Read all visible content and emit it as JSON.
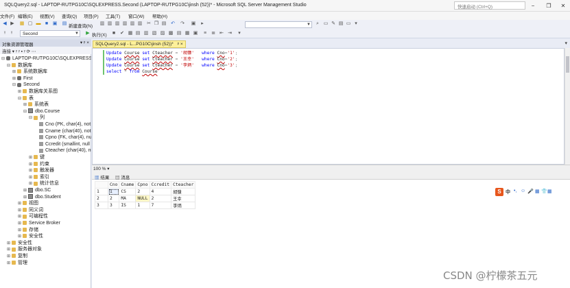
{
  "window": {
    "title": "SQLQuery2.sql - LAPTOP-RUTPG10C\\SQLEXPRESS.Second (LAPTOP-RUTPG10C\\jinsh (52))* - Microsoft SQL Server Management Studio",
    "quick_launch_placeholder": "快速启动 (Ctrl+Q)",
    "minimize": "−",
    "restore": "❐",
    "close": "✕"
  },
  "menu": [
    "文件(F)",
    "编辑(E)",
    "视图(V)",
    "查询(Q)",
    "项目(P)",
    "工具(T)",
    "窗口(W)",
    "帮助(H)"
  ],
  "toolbar": {
    "new_query_label": "新建查询(N)",
    "database_selected": "Second",
    "execute_label": "执行(X)"
  },
  "object_explorer": {
    "header": "对象资源管理器",
    "pins": "▾ ᵖ ×",
    "toolbar": "连接 ▾ ᵞ ᵞ ▪ ᵞ ⟳ ⋯",
    "tree": [
      {
        "label": "LAPTOP-RUTPG10C\\SQLEXPRESS (SC",
        "level": 0,
        "exp": "⊟",
        "icon": "dbi"
      },
      {
        "label": "数据库",
        "level": 1,
        "exp": "⊟",
        "icon": "folder"
      },
      {
        "label": "系统数据库",
        "level": 2,
        "exp": "⊞",
        "icon": "folder"
      },
      {
        "label": "First",
        "level": 2,
        "exp": "⊞",
        "icon": "dbi"
      },
      {
        "label": "Second",
        "level": 2,
        "exp": "⊟",
        "icon": "dbi"
      },
      {
        "label": "数据库关系图",
        "level": 3,
        "exp": "⊞",
        "icon": "folder"
      },
      {
        "label": "表",
        "level": 3,
        "exp": "⊟",
        "icon": "folder"
      },
      {
        "label": "系统表",
        "level": 4,
        "exp": "⊞",
        "icon": "folder"
      },
      {
        "label": "dbo.Course",
        "level": 4,
        "exp": "⊟",
        "icon": "tbli"
      },
      {
        "label": "列",
        "level": 5,
        "exp": "⊟",
        "icon": "folder"
      },
      {
        "label": "Cno (PK, char(4), not",
        "level": 6,
        "exp": "",
        "icon": "coli"
      },
      {
        "label": "Cname (char(40), not",
        "level": 6,
        "exp": "",
        "icon": "coli"
      },
      {
        "label": "Cpno (FK, char(4), nul",
        "level": 6,
        "exp": "",
        "icon": "coli"
      },
      {
        "label": "Ccredit (smallint, null",
        "level": 6,
        "exp": "",
        "icon": "coli"
      },
      {
        "label": "Cteacher (char(40), nu",
        "level": 6,
        "exp": "",
        "icon": "coli"
      },
      {
        "label": "键",
        "level": 5,
        "exp": "⊞",
        "icon": "folder"
      },
      {
        "label": "约束",
        "level": 5,
        "exp": "⊞",
        "icon": "folder"
      },
      {
        "label": "触发器",
        "level": 5,
        "exp": "⊞",
        "icon": "folder"
      },
      {
        "label": "索引",
        "level": 5,
        "exp": "⊞",
        "icon": "folder"
      },
      {
        "label": "统计信息",
        "level": 5,
        "exp": "⊞",
        "icon": "folder"
      },
      {
        "label": "dbo.SC",
        "level": 4,
        "exp": "⊞",
        "icon": "tbli"
      },
      {
        "label": "dbo.Student",
        "level": 4,
        "exp": "⊞",
        "icon": "tbli"
      },
      {
        "label": "视图",
        "level": 3,
        "exp": "⊞",
        "icon": "folder"
      },
      {
        "label": "同义词",
        "level": 3,
        "exp": "⊞",
        "icon": "folder"
      },
      {
        "label": "可编程性",
        "level": 3,
        "exp": "⊞",
        "icon": "folder"
      },
      {
        "label": "Service Broker",
        "level": 3,
        "exp": "⊞",
        "icon": "folder"
      },
      {
        "label": "存储",
        "level": 3,
        "exp": "⊞",
        "icon": "folder"
      },
      {
        "label": "安全性",
        "level": 3,
        "exp": "⊞",
        "icon": "folder"
      },
      {
        "label": "安全性",
        "level": 1,
        "exp": "⊞",
        "icon": "folder"
      },
      {
        "label": "服务器对象",
        "level": 1,
        "exp": "⊞",
        "icon": "folder"
      },
      {
        "label": "复制",
        "level": 1,
        "exp": "⊞",
        "icon": "folder"
      },
      {
        "label": "管理",
        "level": 1,
        "exp": "⊞",
        "icon": "folder"
      }
    ]
  },
  "editor": {
    "tab_title": "SQLQuery2.sql - L...PG10C\\jinsh (52))*",
    "tab_pin": "ᵖ ×",
    "code": [
      {
        "parts": [
          [
            "kw",
            "Update"
          ],
          [
            "t",
            " "
          ],
          [
            "ident",
            "Course"
          ],
          [
            "t",
            " "
          ],
          [
            "kw",
            "set"
          ],
          [
            "t",
            " "
          ],
          [
            "ident",
            "Cteacher"
          ],
          [
            "t",
            " "
          ],
          [
            "gray",
            "="
          ],
          [
            "t",
            " "
          ],
          [
            "str",
            "'胡慷'"
          ],
          [
            "t",
            "   "
          ],
          [
            "kw",
            "where"
          ],
          [
            "t",
            " "
          ],
          [
            "ident",
            "Cno"
          ],
          [
            "gray",
            "="
          ],
          [
            "str",
            "'1'"
          ],
          [
            "gray",
            ";"
          ]
        ]
      },
      {
        "parts": [
          [
            "kw",
            "Update"
          ],
          [
            "t",
            " "
          ],
          [
            "ident",
            "Course"
          ],
          [
            "t",
            " "
          ],
          [
            "kw",
            "set"
          ],
          [
            "t",
            " "
          ],
          [
            "ident",
            "Cteacher"
          ],
          [
            "t",
            " "
          ],
          [
            "gray",
            "="
          ],
          [
            "t",
            " "
          ],
          [
            "str",
            "'王幸'"
          ],
          [
            "t",
            "   "
          ],
          [
            "kw",
            "where"
          ],
          [
            "t",
            " "
          ],
          [
            "ident",
            "Cno"
          ],
          [
            "gray",
            "="
          ],
          [
            "str",
            "'2'"
          ],
          [
            "gray",
            ";"
          ]
        ]
      },
      {
        "parts": [
          [
            "kw",
            "Update"
          ],
          [
            "t",
            " "
          ],
          [
            "ident",
            "Course"
          ],
          [
            "t",
            " "
          ],
          [
            "kw",
            "set"
          ],
          [
            "t",
            " "
          ],
          [
            "ident",
            "Cteacher"
          ],
          [
            "t",
            " "
          ],
          [
            "gray",
            "="
          ],
          [
            "t",
            " "
          ],
          [
            "str",
            "'李炳'"
          ],
          [
            "t",
            "   "
          ],
          [
            "kw",
            "where"
          ],
          [
            "t",
            " "
          ],
          [
            "ident",
            "Cno"
          ],
          [
            "gray",
            "="
          ],
          [
            "str",
            "'3'"
          ],
          [
            "gray",
            ";"
          ]
        ]
      },
      {
        "parts": [
          [
            "kw",
            "select"
          ],
          [
            "t",
            " "
          ],
          [
            "gray",
            "*"
          ],
          [
            "t",
            " "
          ],
          [
            "kw",
            "from"
          ],
          [
            "t",
            " "
          ],
          [
            "ident",
            "Course"
          ]
        ]
      }
    ],
    "zoom": "100 %"
  },
  "results": {
    "tab_results": "结果",
    "tab_messages": "消息",
    "columns": [
      "Cno",
      "Cname",
      "Cpno",
      "Ccredit",
      "Cteacher"
    ],
    "rows": [
      [
        "1",
        "1",
        "CS",
        "2",
        "4",
        "胡慷"
      ],
      [
        "2",
        "2",
        "MA",
        "NULL",
        "2",
        "王幸"
      ],
      [
        "3",
        "3",
        "IS",
        "1",
        "7",
        "李炳"
      ]
    ]
  },
  "ime_bar": {
    "logo": "S",
    "mode": "中",
    "items": [
      "•,",
      "☺",
      "🎤",
      "▦",
      "👕",
      "▦"
    ]
  },
  "watermark": "CSDN @柠檬茶五元"
}
